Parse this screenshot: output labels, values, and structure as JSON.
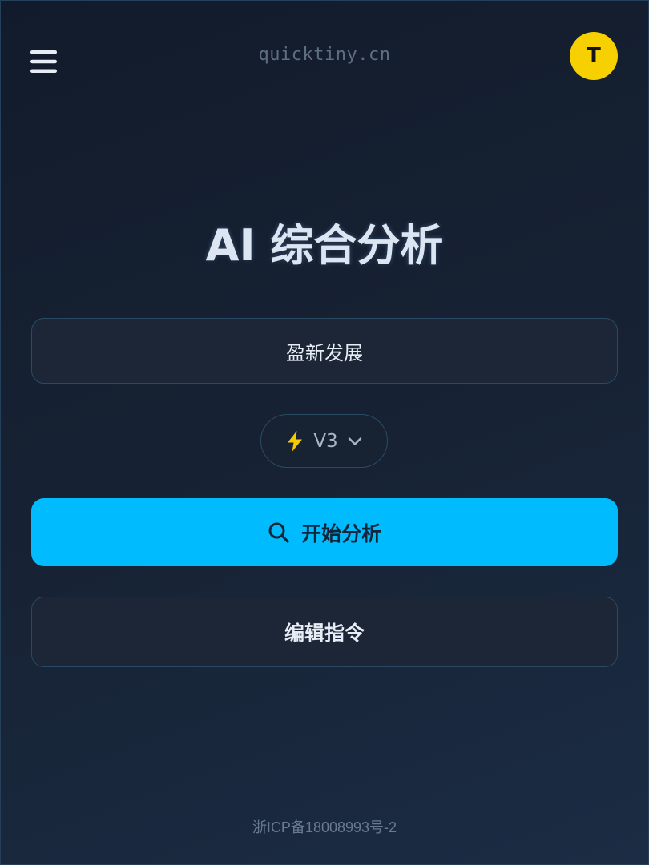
{
  "header": {
    "menu_icon": "hamburger-menu-icon",
    "domain": "quicktiny.cn",
    "avatar_initial": "T",
    "avatar_color": "#f6d000"
  },
  "main": {
    "title": "AI 综合分析",
    "company_value": "盈新发展",
    "model": {
      "icon": "lightning-bolt-icon",
      "selected": "V3",
      "dropdown_icon": "chevron-down-icon"
    },
    "start_button": {
      "icon": "search-icon",
      "label": "开始分析",
      "color": "#00bcff"
    },
    "edit_button": {
      "label": "编辑指令"
    }
  },
  "footer": {
    "icp": "浙ICP备18008993号-2"
  }
}
